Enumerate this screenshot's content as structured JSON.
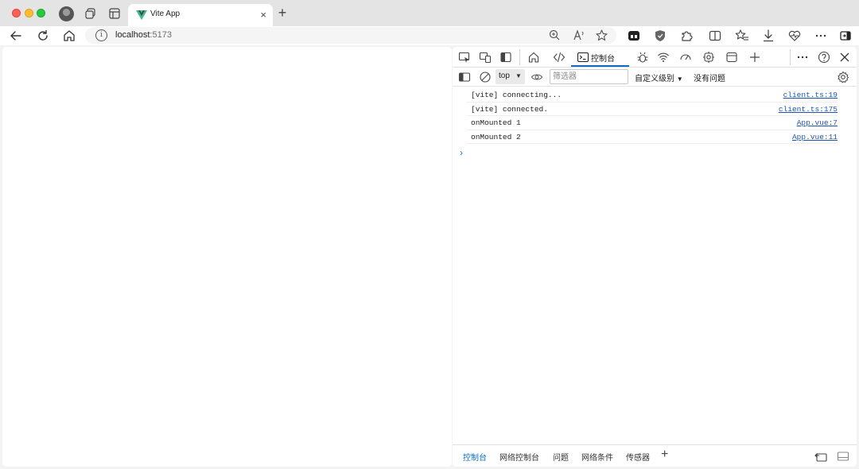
{
  "browser": {
    "tab": {
      "title": "Vite App",
      "close": "×"
    },
    "new_tab": "+",
    "address": {
      "host": "localhost",
      "port": ":5173",
      "info": "i"
    }
  },
  "devtools": {
    "active_tab": "控制台",
    "filter_bar": {
      "context": "top",
      "context_arrow": "▼",
      "filter_placeholder": "筛选器",
      "levels": "自定义级别",
      "levels_arrow": "▼",
      "issues": "没有问题"
    },
    "console": {
      "messages": [
        {
          "text": "[vite] connecting...",
          "source": "client.ts:19"
        },
        {
          "text": "[vite] connected.",
          "source": "client.ts:175"
        },
        {
          "text": "onMounted 1",
          "source": "App.vue:7"
        },
        {
          "text": "onMounted 2",
          "source": "App.vue:11"
        }
      ],
      "prompt": "›"
    },
    "drawer": {
      "tabs": [
        "控制台",
        "网络控制台",
        "问题",
        "网络条件",
        "传感器"
      ],
      "add": "+"
    }
  },
  "colors": {
    "accent": "#0f6cbd",
    "link": "#1a55b0",
    "vue_green": "#41b883",
    "vue_dark": "#35495e"
  }
}
